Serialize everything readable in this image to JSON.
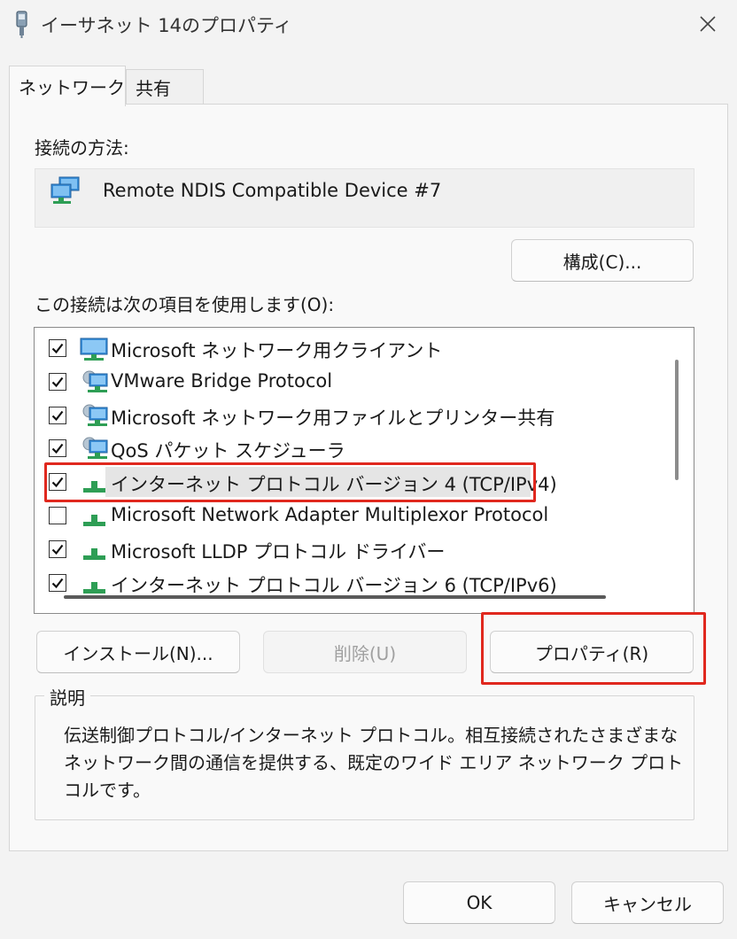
{
  "window": {
    "title": "イーサネット 14のプロパティ",
    "icon": "network-adapter-icon",
    "close_icon": "close-icon"
  },
  "tabs": [
    {
      "label": "ネットワーク",
      "active": true
    },
    {
      "label": "共有",
      "active": false
    }
  ],
  "connection": {
    "label": "接続の方法:",
    "device_name": "Remote NDIS Compatible Device #7",
    "configure_button": "構成(C)..."
  },
  "items_section": {
    "label": "この接続は次の項目を使用します(O):",
    "items": [
      {
        "label": "Microsoft ネットワーク用クライアント",
        "checked": true,
        "icon": "client-icon"
      },
      {
        "label": "VMware Bridge Protocol",
        "checked": true,
        "icon": "service-icon"
      },
      {
        "label": "Microsoft ネットワーク用ファイルとプリンター共有",
        "checked": true,
        "icon": "service-icon"
      },
      {
        "label": "QoS パケット スケジューラ",
        "checked": true,
        "icon": "service-icon"
      },
      {
        "label": "インターネット プロトコル バージョン 4 (TCP/IPv4)",
        "checked": true,
        "selected": true,
        "icon": "protocol-icon"
      },
      {
        "label": "Microsoft Network Adapter Multiplexor Protocol",
        "checked": false,
        "icon": "protocol-icon"
      },
      {
        "label": "Microsoft LLDP プロトコル ドライバー",
        "checked": true,
        "icon": "protocol-icon"
      },
      {
        "label": "インターネット プロトコル バージョン 6 (TCP/IPv6)",
        "checked": true,
        "icon": "protocol-icon"
      }
    ]
  },
  "buttons": {
    "install": "インストール(N)...",
    "uninstall": "削除(U)",
    "properties": "プロパティ(R)"
  },
  "description": {
    "title": "説明",
    "text": "伝送制御プロトコル/インターネット プロトコル。相互接続されたさまざまなネットワーク間の通信を提供する、既定のワイド エリア ネットワーク プロトコルです。"
  },
  "footer": {
    "ok": "OK",
    "cancel": "キャンセル"
  },
  "colors": {
    "highlight": "#e0281e",
    "selection": "#e5e5e5",
    "monitor_blue": "#3a8fd8",
    "protocol_green": "#2e9e55"
  }
}
